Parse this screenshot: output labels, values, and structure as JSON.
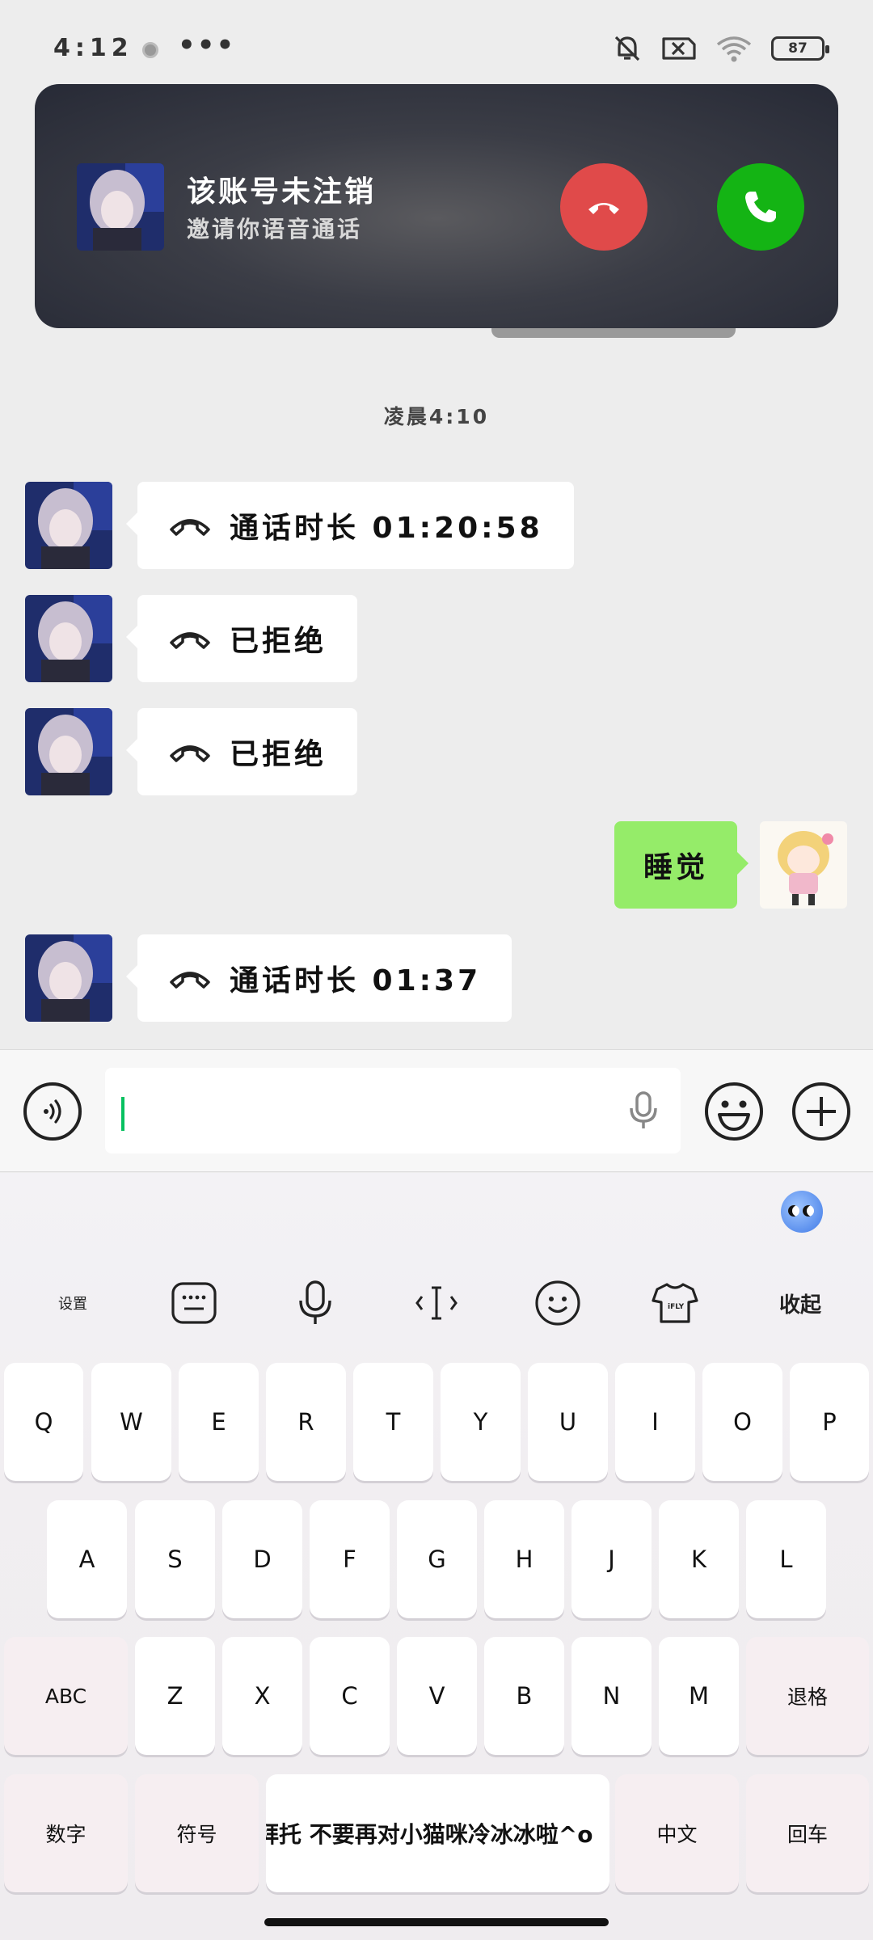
{
  "status_bar": {
    "time": "4:12",
    "more": "•••",
    "battery": "87",
    "icons": [
      "notification-dot-icon",
      "mute-bell-icon",
      "no-sim-icon",
      "wifi-icon",
      "battery-icon"
    ]
  },
  "incoming_call": {
    "caller_name": "该账号未注销",
    "subtitle": "邀请你语音通话",
    "decline_icon": "hang-up-icon",
    "accept_icon": "phone-icon",
    "colors": {
      "decline": "#e04a4a",
      "accept": "#14b414"
    }
  },
  "chat": {
    "timestamp": "凌晨4:10",
    "messages": [
      {
        "side": "left",
        "icon": "phone-hangup-icon",
        "text": "通话时长 01:20:58"
      },
      {
        "side": "left",
        "icon": "phone-hangup-icon",
        "text": "已拒绝"
      },
      {
        "side": "left",
        "icon": "phone-hangup-icon",
        "text": "已拒绝"
      },
      {
        "side": "right",
        "text": "睡觉"
      },
      {
        "side": "left",
        "icon": "phone-hangup-icon",
        "text": "通话时长 01:37"
      }
    ],
    "colors": {
      "self_bubble": "#95ec69",
      "other_bubble": "#ffffff",
      "background": "#ededed"
    }
  },
  "input_bar": {
    "value": "",
    "icons": [
      "voice-toggle-icon",
      "microphone-icon",
      "emoji-icon",
      "plus-icon"
    ]
  },
  "keyboard": {
    "toolbar": {
      "settings": "设置",
      "collapse": "收起",
      "icons": [
        "keyboard-icon",
        "microphone-icon",
        "cursor-icon",
        "emoji-icon",
        "skin-icon"
      ]
    },
    "row1": [
      "Q",
      "W",
      "E",
      "R",
      "T",
      "Y",
      "U",
      "I",
      "O",
      "P"
    ],
    "row2": [
      "A",
      "S",
      "D",
      "F",
      "G",
      "H",
      "J",
      "K",
      "L"
    ],
    "row3_left": "ABC",
    "row3": [
      "Z",
      "X",
      "C",
      "V",
      "B",
      "N",
      "M"
    ],
    "row3_right": "退格",
    "bottom": {
      "numbers": "数字",
      "symbols": "符号",
      "space_text": "拜托 不要再对小猫咪冷冰冰啦^o",
      "chinese": "中文",
      "enter": "回车"
    }
  }
}
